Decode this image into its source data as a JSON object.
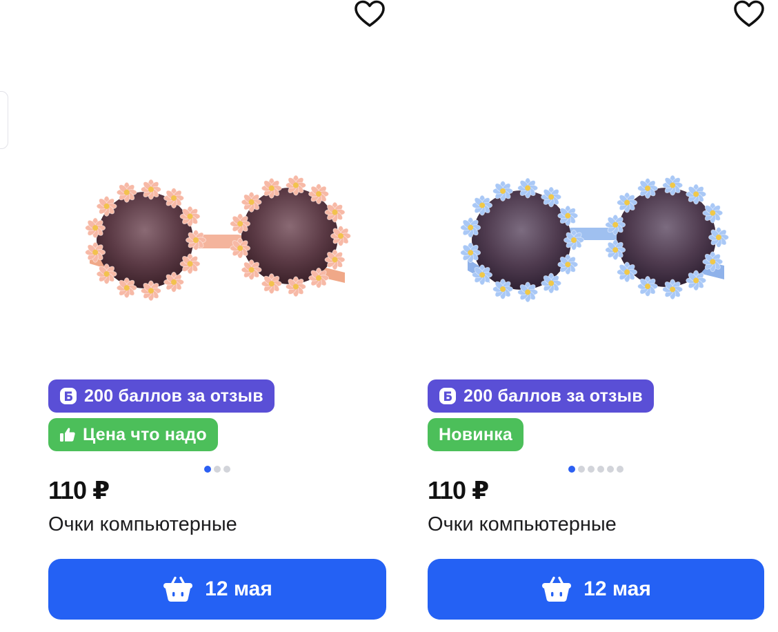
{
  "colors": {
    "accent_button": "#2461f4",
    "points_badge": "#5a4fd6",
    "promo_badge": "#4cbf5a",
    "dot_active": "#2b5ff2",
    "dot_inactive": "#d2d4da"
  },
  "products": [
    {
      "frame_color": "peach",
      "points_badge": {
        "icon": "points-b-icon",
        "text": "200 баллов за отзыв"
      },
      "tag_badge": {
        "icon": "thumbs-up-icon",
        "text": "Цена что надо"
      },
      "gallery": {
        "total": 3,
        "active": 1
      },
      "price": "110 ₽",
      "title": "Очки компьютерные",
      "button": {
        "icon": "basket-icon",
        "label": "12 мая"
      },
      "favorite_icon": "heart-outline-icon"
    },
    {
      "frame_color": "light-blue",
      "points_badge": {
        "icon": "points-b-icon",
        "text": "200 баллов за отзыв"
      },
      "tag_badge": {
        "text": "Новинка"
      },
      "gallery": {
        "total": 6,
        "active": 1
      },
      "price": "110 ₽",
      "title": "Очки компьютерные",
      "button": {
        "icon": "basket-icon",
        "label": "12 мая"
      },
      "favorite_icon": "heart-outline-icon"
    }
  ]
}
